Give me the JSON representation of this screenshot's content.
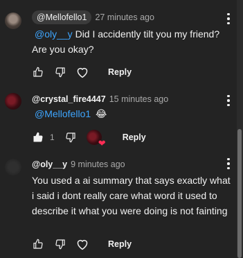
{
  "comments": [
    {
      "handle": "@Mellofello1",
      "time": "27 minutes ago",
      "mention": "@oly__y",
      "line1_rest": " Did I accidently tilt you my friend?",
      "line2": "Are you okay?",
      "reply_label": "Reply"
    },
    {
      "handle": "@crystal_fire4447",
      "time": "15 minutes ago",
      "mention": "@Mellofello1",
      "emoji": "😂",
      "like_count": "1",
      "reply_label": "Reply"
    },
    {
      "handle": "@oly__y",
      "time": "9 minutes ago",
      "body": "You used a ai summary that says exactly what i said i dont really care what word it used to describe it what you were doing is not fainting",
      "reply_label": "Reply"
    }
  ],
  "icons": {
    "like": "thumbs-up-icon",
    "dislike": "thumbs-down-icon",
    "heart": "heart-icon",
    "more": "more-vert-icon"
  },
  "colors": {
    "background": "#232323",
    "mention": "#3ea6ff",
    "heart": "#ff2d55",
    "muted": "#aaaaaa"
  }
}
